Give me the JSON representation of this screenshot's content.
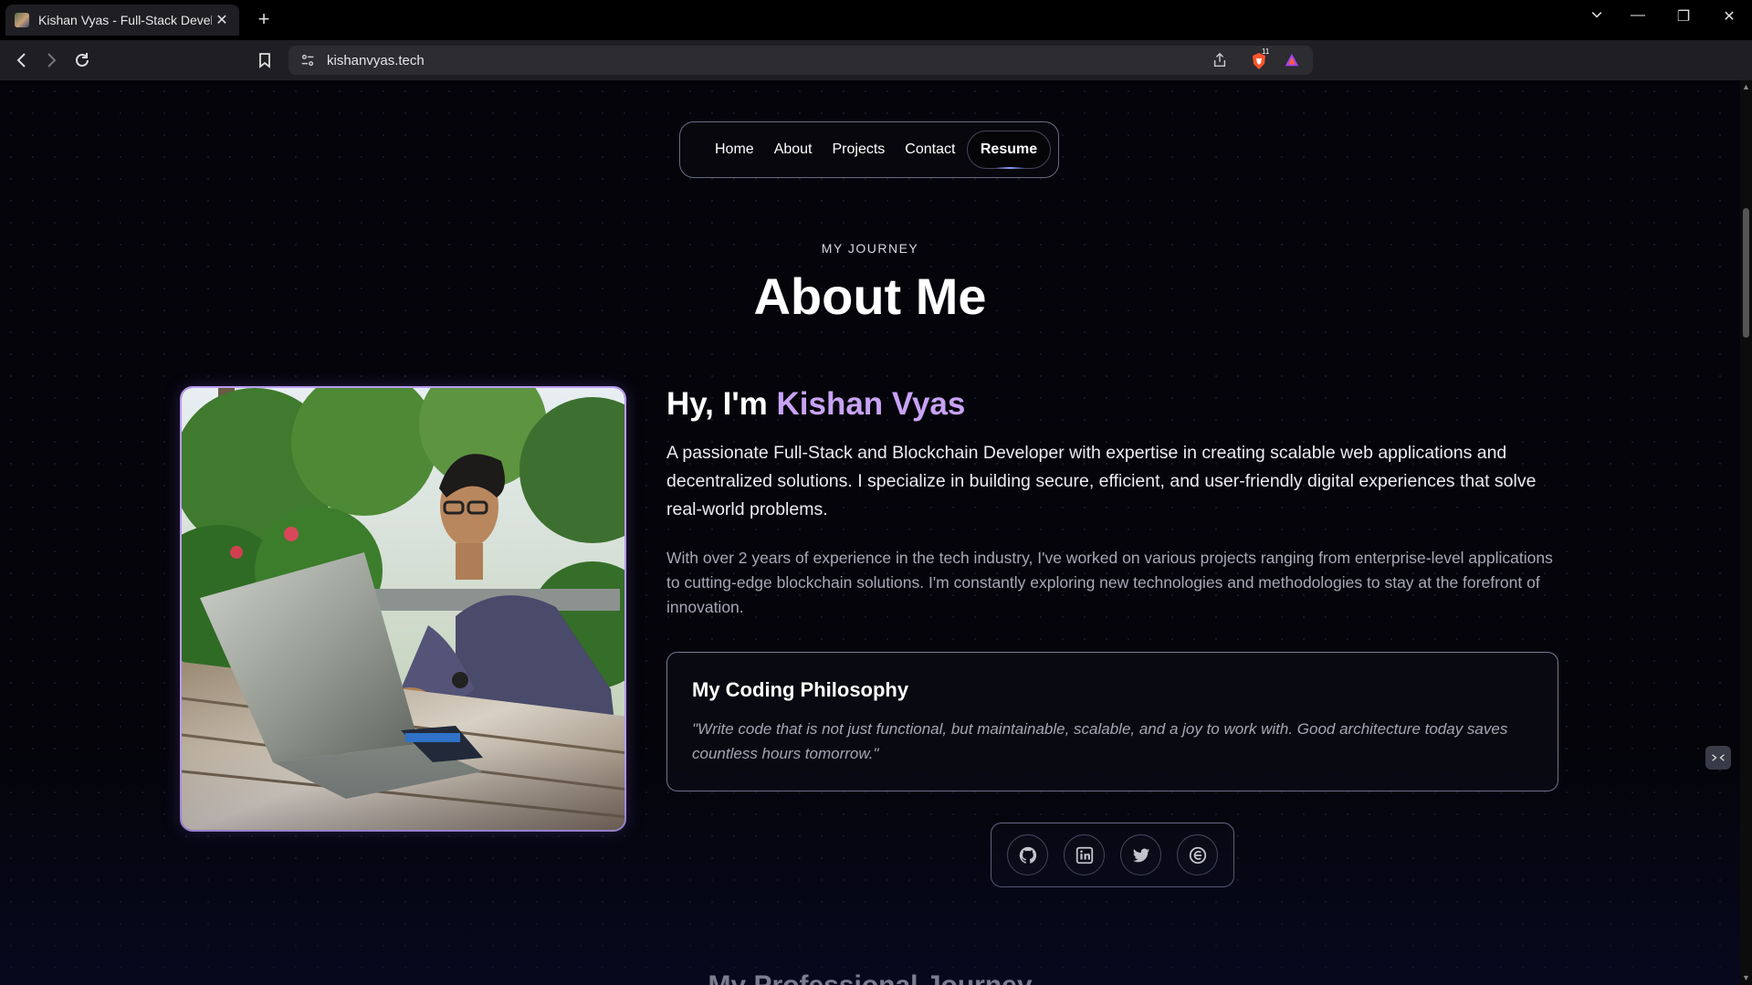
{
  "browser": {
    "tab_title": "Kishan Vyas - Full-Stack Developer",
    "url": "kishanvyas.tech",
    "ext_badge": "11"
  },
  "nav": {
    "links": [
      "Home",
      "About",
      "Projects",
      "Contact"
    ],
    "resume_label": "Resume"
  },
  "about": {
    "eyebrow": "MY JOURNEY",
    "heading": "About Me",
    "greeting": "Hy, I'm ",
    "name": "Kishan Vyas",
    "lead": "A passionate Full-Stack and Blockchain Developer with expertise in creating scalable web applications and decentralized solutions. I specialize in building secure, efficient, and user-friendly digital experiences that solve real-world problems.",
    "body": "With over 2 years of experience in the tech industry, I've worked on various projects ranging from enterprise-level applications to cutting-edge blockchain solutions. I'm constantly exploring new technologies and methodologies to stay at the forefront of innovation.",
    "philosophy_title": "My Coding Philosophy",
    "philosophy_quote": "\"Write code that is not just functional, but maintainable, scalable, and a joy to work with. Good architecture today saves countless hours tomorrow.\"",
    "socials": [
      "github-icon",
      "linkedin-icon",
      "twitter-icon",
      "dev-icon"
    ]
  },
  "next_section": {
    "heading": "My Professional Journey"
  },
  "colors": {
    "accent_name": "#c8a2f5",
    "page_bg": "#04040a",
    "border": "#7a7a94"
  }
}
